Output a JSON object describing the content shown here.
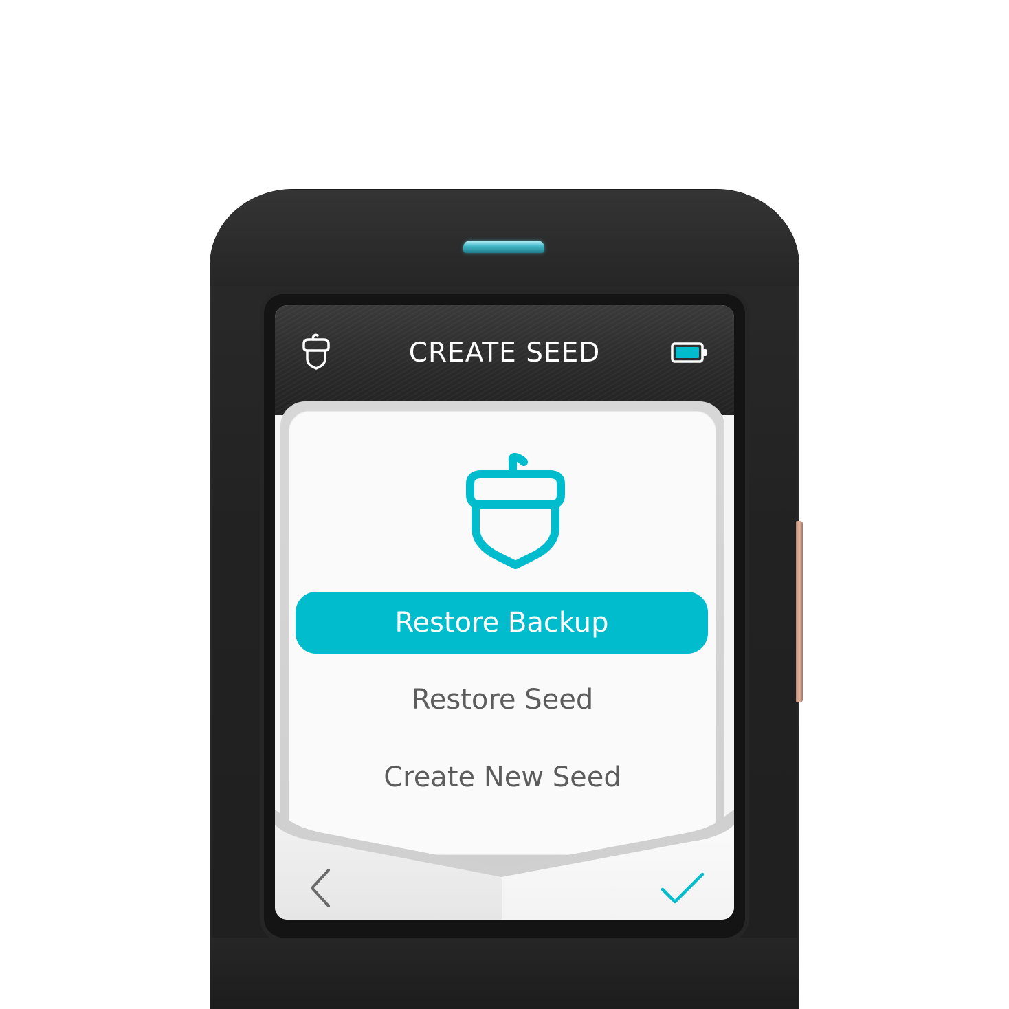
{
  "device": {
    "name": "Hardware wallet",
    "led_color": "#43b9c9",
    "accent": "#00bccd"
  },
  "header": {
    "title": "CREATE SEED",
    "left_icon": "acorn-icon",
    "right_icon": "battery-icon"
  },
  "main": {
    "hero_icon": "acorn-icon",
    "primary_button_label": "Restore Backup",
    "options": [
      {
        "label": "Restore Seed"
      },
      {
        "label": "Create New Seed"
      }
    ]
  },
  "footer": {
    "back_icon": "chevron-left-icon",
    "confirm_icon": "checkmark-icon"
  }
}
